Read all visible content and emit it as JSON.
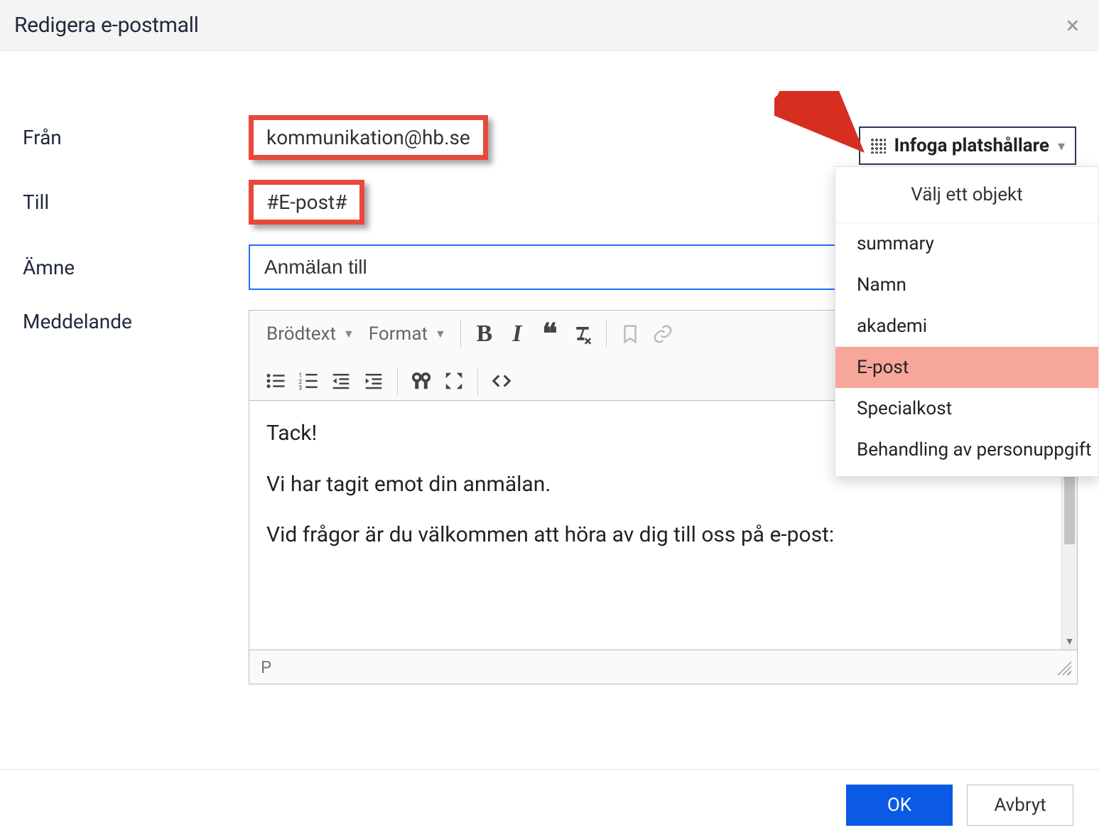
{
  "header": {
    "title": "Redigera e-postmall"
  },
  "labels": {
    "from": "Från",
    "to": "Till",
    "subject": "Ämne",
    "message": "Meddelande"
  },
  "fields": {
    "from_value": "kommunikation@hb.se",
    "to_value": "#E-post#",
    "subject_value": "Anmälan till"
  },
  "toolbar": {
    "paragraph_label": "Brödtext",
    "format_label": "Format"
  },
  "editor": {
    "lines": [
      "Tack!",
      "Vi har tagit emot din anmälan.",
      "Vid frågor är du välkommen att höra av dig till oss på e-post:"
    ],
    "status_path": "P"
  },
  "placeholder": {
    "button_label": "Infoga platshållare",
    "panel_header": "Välj ett objekt",
    "items": [
      "summary",
      "Namn",
      "akademi",
      "E-post",
      "Specialkost",
      "Behandling av personuppgift"
    ],
    "highlight_index": 3
  },
  "footer": {
    "ok": "OK",
    "cancel": "Avbryt"
  }
}
